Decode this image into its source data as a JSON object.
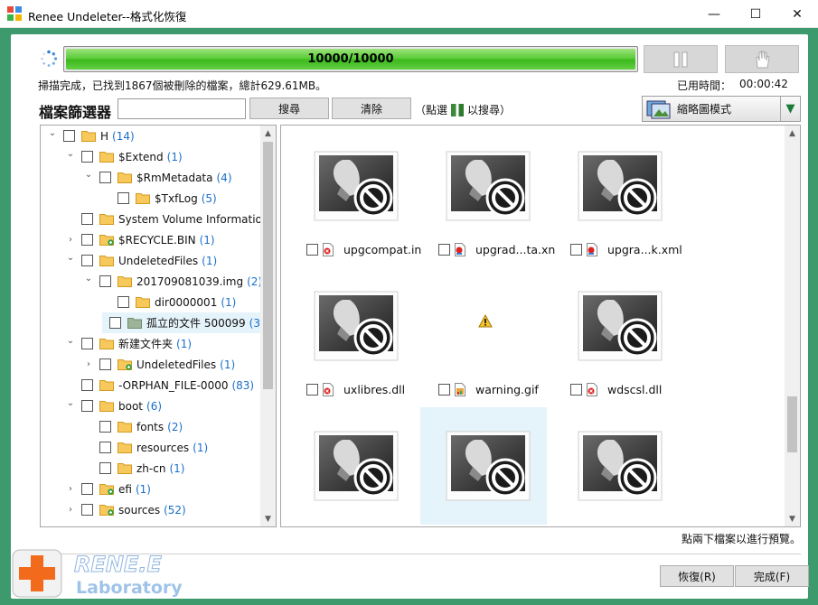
{
  "window": {
    "title": "Renee Undeleter--格式化恢復",
    "minimize": "—",
    "maximize": "☐",
    "close": "✕"
  },
  "scan": {
    "progress_text": "10000/10000",
    "progress_fraction": 1.0,
    "status": "掃描完成，已找到1867個被刪除的檔案，總計629.61MB。",
    "elapsed_label": "已用時間：",
    "elapsed": "00:00:42"
  },
  "filter": {
    "label": "檔案篩選器",
    "input_value": "",
    "search_button": "搜尋",
    "clear_button": "清除",
    "hint_before": "（點選",
    "hint_after": "以搜尋）"
  },
  "view_mode": {
    "label": "縮略圖模式"
  },
  "tree": [
    {
      "name": "H",
      "count": "(14)",
      "expand": "open",
      "level": 0,
      "folder": "plain"
    },
    {
      "name": "$Extend",
      "count": "(1)",
      "expand": "open",
      "level": 1,
      "folder": "plain"
    },
    {
      "name": "$RmMetadata",
      "count": "(4)",
      "expand": "open",
      "level": 2,
      "folder": "plain"
    },
    {
      "name": "$TxfLog",
      "count": "(5)",
      "expand": "none",
      "level": 3,
      "folder": "plain"
    },
    {
      "name": "System Volume Information",
      "count": "",
      "expand": "none",
      "level": 1,
      "folder": "plain"
    },
    {
      "name": "$RECYCLE.BIN",
      "count": "(1)",
      "expand": "closed",
      "level": 1,
      "folder": "green"
    },
    {
      "name": "UndeletedFiles",
      "count": "(1)",
      "expand": "open",
      "level": 1,
      "folder": "plain"
    },
    {
      "name": "201709081039.img",
      "count": "(2)",
      "expand": "open",
      "level": 2,
      "folder": "plain"
    },
    {
      "name": "dir0000001",
      "count": "(1)",
      "expand": "none",
      "level": 3,
      "folder": "plain"
    },
    {
      "name": "孤立的文件 500099",
      "count": "(3",
      "expand": "none",
      "level": 3,
      "folder": "gray",
      "selected": true
    },
    {
      "name": "新建文件夹",
      "count": "(1)",
      "expand": "open",
      "level": 1,
      "folder": "plain"
    },
    {
      "name": "UndeletedFiles",
      "count": "(1)",
      "expand": "closed",
      "level": 2,
      "folder": "green"
    },
    {
      "name": "-ORPHAN_FILE-0000",
      "count": "(83)",
      "expand": "none",
      "level": 1,
      "folder": "plain"
    },
    {
      "name": "boot",
      "count": "(6)",
      "expand": "open",
      "level": 1,
      "folder": "plain"
    },
    {
      "name": "fonts",
      "count": "(2)",
      "expand": "none",
      "level": 2,
      "folder": "plain"
    },
    {
      "name": "resources",
      "count": "(1)",
      "expand": "none",
      "level": 2,
      "folder": "plain"
    },
    {
      "name": "zh-cn",
      "count": "(1)",
      "expand": "none",
      "level": 2,
      "folder": "plain"
    },
    {
      "name": "efi",
      "count": "(1)",
      "expand": "closed",
      "level": 1,
      "folder": "green"
    },
    {
      "name": "sources",
      "count": "(52)",
      "expand": "closed",
      "level": 1,
      "folder": "green"
    }
  ],
  "files": [
    {
      "name": "upgcompat.in",
      "type": "broken",
      "icon": "doc-red"
    },
    {
      "name": "upgrad...ta.xn",
      "type": "broken",
      "icon": "doc-xml"
    },
    {
      "name": "upgra...k.xml",
      "type": "broken",
      "icon": "doc-xml"
    },
    {
      "name": "uxlibres.dll",
      "type": "broken",
      "icon": "doc-red"
    },
    {
      "name": "warning.gif",
      "type": "warning",
      "icon": "doc-gif"
    },
    {
      "name": "wdscsl.dll",
      "type": "broken",
      "icon": "doc-red"
    },
    {
      "name": "",
      "type": "broken",
      "icon": "none"
    },
    {
      "name": "",
      "type": "broken",
      "icon": "none",
      "selected": true
    },
    {
      "name": "",
      "type": "broken",
      "icon": "none"
    }
  ],
  "preview_hint": "點兩下檔案以進行預覽。",
  "footer": {
    "recover_button": "恢復(R)",
    "finish_button": "完成(F)",
    "logo_top": "RENE.E",
    "logo_bottom": "Laboratory"
  },
  "colors": {
    "frame": "#3d9a6c",
    "progress": "#4bc62a",
    "accent_blue": "#1a6fc9"
  }
}
